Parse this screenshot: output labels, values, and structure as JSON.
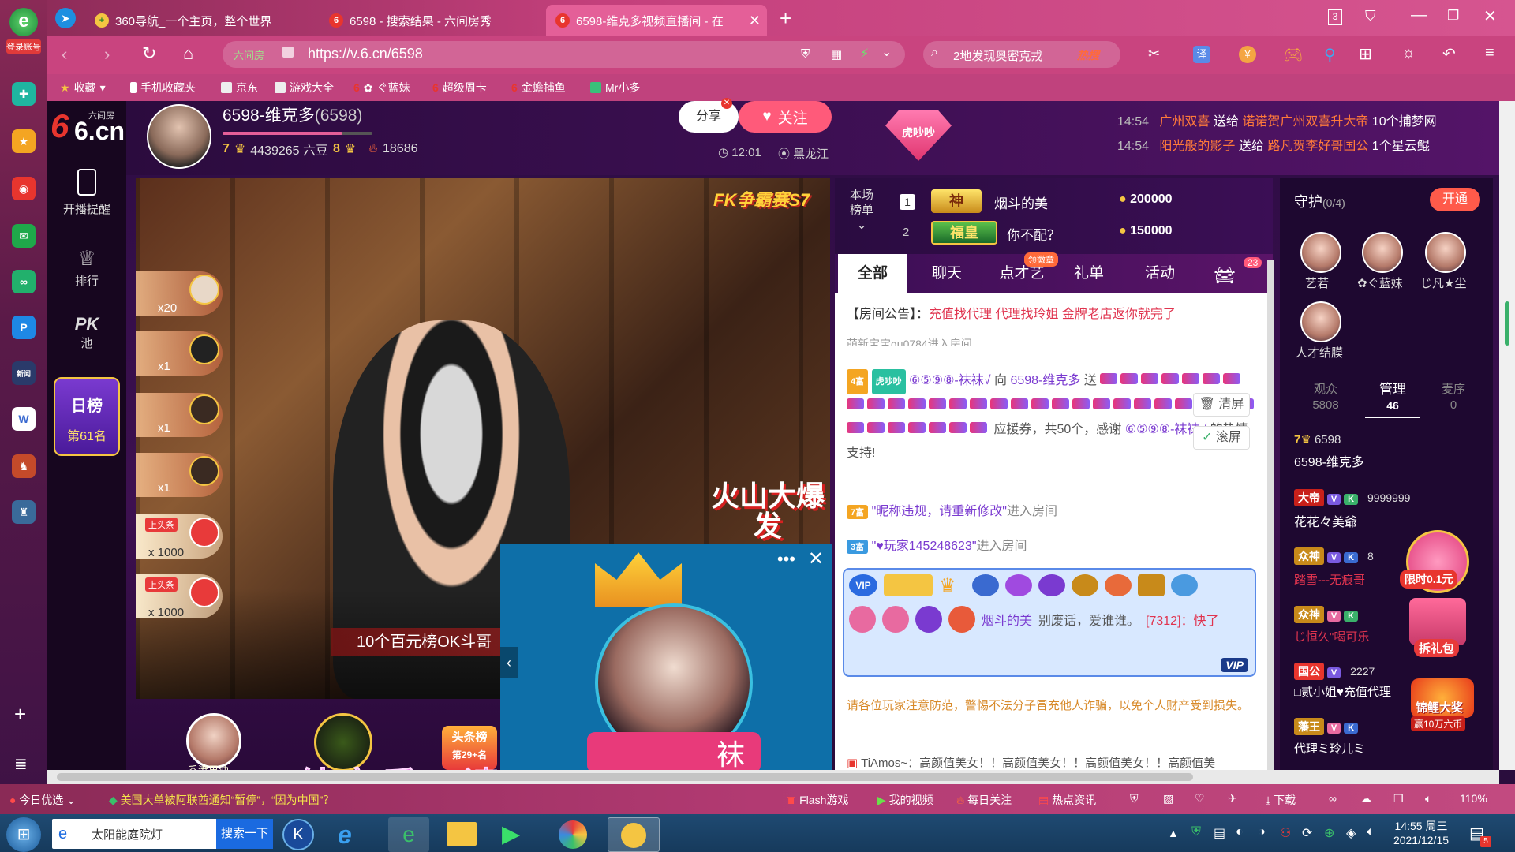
{
  "browser": {
    "tabs": [
      {
        "label": "360导航_一个主页，整个世界"
      },
      {
        "label": "6598 - 搜索结果 - 六间房秀"
      },
      {
        "label": "6598-维克多视频直播间 - 在"
      }
    ],
    "tab_counter": "3",
    "url_prefix": "六间房",
    "url": "https://v.6.cn/6598",
    "search_text": "2地发现奥密克戎",
    "search_hot": "热搜",
    "bookmarks": [
      "收藏",
      "手机收藏夹",
      "京东",
      "游戏大全",
      "ぐ蓝妹",
      "超级周卡",
      "金蟾捕鱼",
      "Mr小多"
    ],
    "login_label": "登录账号"
  },
  "site": {
    "logo_text": "6.cn",
    "logo_sub": "六间房",
    "nav": [
      {
        "label": "开播提醒",
        "icon": "phone-icon"
      },
      {
        "label": "排行",
        "icon": "crown-icon"
      },
      {
        "label": "池",
        "icon": "pk-icon",
        "pk": "PK"
      }
    ],
    "daily_rank": {
      "title": "日榜",
      "rank": "第61名"
    }
  },
  "anchor": {
    "name": "6598-维克多",
    "room_id": "(6598)",
    "level": "7",
    "beans": "4439265 六豆",
    "fortune_level": "8",
    "fans": "18686",
    "share_label": "分享",
    "follow_label": "关注",
    "time": "12:01",
    "location": "黑龙江"
  },
  "top_messages": [
    {
      "time": "14:54",
      "sender": "广州双喜",
      "action": "送给",
      "receiver": "诺诺贺广州双喜升大帝",
      "gift": "10个捕梦网"
    },
    {
      "time": "14:54",
      "sender": "阳光般的影子",
      "action": "送给",
      "receiver": "路凡贺李好哥国公",
      "gift": "1个星云鲲"
    }
  ],
  "badge_text": "虎吵吵",
  "video": {
    "event_badge": "FK争霸赛S7",
    "promo_text": "火山大爆发",
    "banner_text": "10个百元榜OK斗哥",
    "subtitle": "纯音乐，请欣赏",
    "headline_badge": "头条榜",
    "headline_rank": "第29+名",
    "bottom_user": "香港果油",
    "gift_rows": [
      "x20",
      "x1",
      "x1",
      "x1",
      "x 1000",
      "x 1000"
    ],
    "gift_tag": "上头条"
  },
  "pip": {
    "name": "袜"
  },
  "rank_board": {
    "label": "本场榜单",
    "rows": [
      {
        "rank": "1",
        "title": "神",
        "name": "烟斗的美",
        "coins": "200000"
      },
      {
        "rank": "2",
        "title": "福皇",
        "name": "你不配？",
        "coins": "150000"
      }
    ]
  },
  "chat": {
    "tabs": [
      "全部",
      "聊天",
      "点才艺",
      "礼单",
      "活动"
    ],
    "tab_badge": "领徽章",
    "car_count": "23",
    "announcement_label": "【房间公告】：",
    "announcement": "充值找代理 代理找玲姐 金牌老店返你就完了",
    "partial_line": "萌新宝宝qu0784进入房间",
    "gift_msg": {
      "wealth": "4富",
      "club": "虎吵吵",
      "user": "⑥⑤⑨⑧-袜袜√",
      "to": "向",
      "target": "6598-维克多",
      "send": "送",
      "tail": "应援券，共50个，感谢",
      "thanks_user": "⑥⑤⑨⑧-袜袜√",
      "thanks_tail": "的热情支持!"
    },
    "clear_label": "清屏",
    "scroll_label": "滚屏",
    "enter1": {
      "wealth": "7富",
      "user": "\"昵称违规，请重新修改\"",
      "tail": "进入房间"
    },
    "enter2": {
      "wealth": "3富",
      "user": "\"♥玩家145248623\"",
      "tail": "进入房间"
    },
    "vip_msg": {
      "user": "烟斗的美",
      "text": "别废话，爱谁谁。",
      "count": "[7312]：快了",
      "vip": "VIP"
    },
    "warning": "请各位玩家注意防范，警惕不法分子冒充他人诈骗，以免个人财产受到损失。",
    "last_msg": "TiAmos~：高颜值美女！！高颜值美女！！高颜值美女！！高颜值美"
  },
  "guard": {
    "title": "守护",
    "count": "(0/4)",
    "open_label": "开通",
    "members": [
      {
        "name": "艺若"
      },
      {
        "name": "✿ぐ蓝妹"
      },
      {
        "name": "じ凡★尘"
      },
      {
        "name": "人才结膜"
      }
    ],
    "tabs": [
      {
        "label": "观众",
        "value": "5808"
      },
      {
        "label": "管理",
        "value": "46"
      },
      {
        "label": "麦序",
        "value": "0"
      }
    ],
    "admins": [
      {
        "level": "7",
        "id": "6598",
        "name": "6598-维克多"
      },
      {
        "title": "大帝",
        "num": "9999999",
        "name": "花花々美爺"
      },
      {
        "title": "众神",
        "num": "8",
        "name": "踏雪---无痕哥"
      },
      {
        "title": "众神",
        "name": "じ恒久\"喝可乐"
      },
      {
        "title": "国公",
        "num": "2227",
        "name": "□贰小姐♥充值代理"
      },
      {
        "title": "藩王",
        "name": "代理ミ玲儿ミ"
      }
    ],
    "promo1": "限时0.1元",
    "promo2": "拆礼包",
    "promo3": "锦鲤大奖",
    "promo3_sub": "赢10万六币"
  },
  "statusbar": {
    "today": "今日优选",
    "news": "美国大单被阿联酋通知“暂停”，“因为中国”？",
    "items": [
      "Flash游戏",
      "我的视频",
      "每日关注",
      "热点资讯",
      "下载"
    ],
    "zoom": "110%"
  },
  "taskbar": {
    "search_placeholder": "太阳能庭院灯",
    "search_button": "搜索一下",
    "time": "14:55 周三",
    "date": "2021/12/15",
    "notify_count": "5"
  },
  "colors": {
    "accent": "#e45f98",
    "follow": "#ff5a7a",
    "gold": "#f4c542",
    "chat_red": "#e0344f"
  }
}
